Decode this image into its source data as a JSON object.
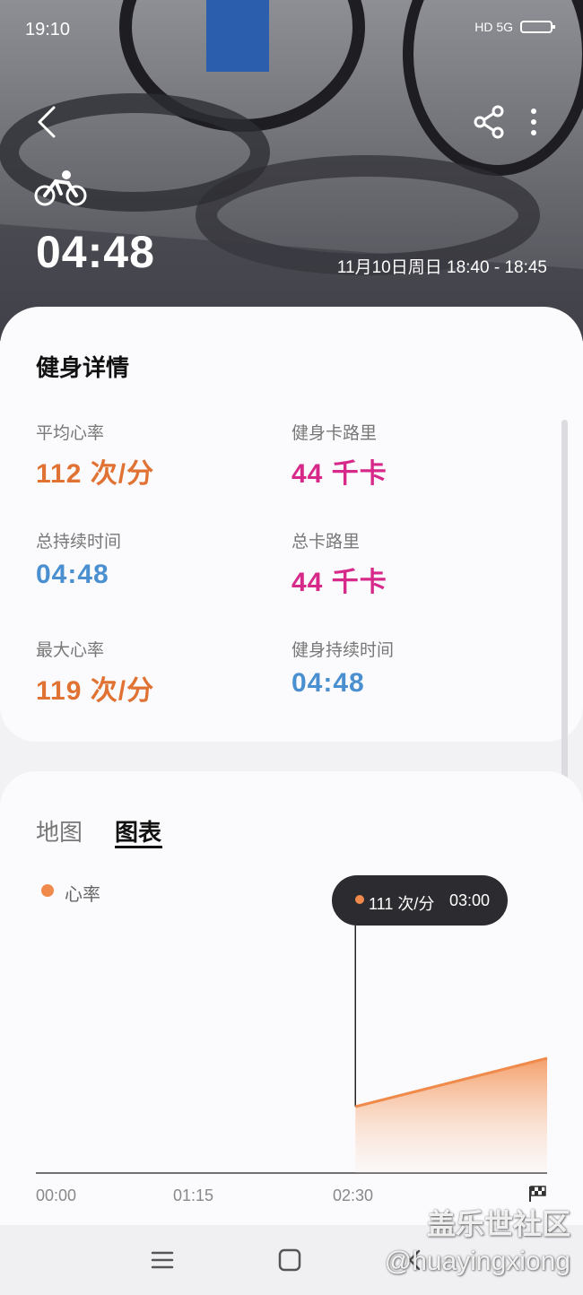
{
  "status_bar": {
    "time": "19:10",
    "indicators": "HD 5G"
  },
  "header": {
    "duration": "04:48",
    "date_range": "11月10日周日 18:40 - 18:45",
    "icons": [
      "back-icon",
      "share-icon",
      "more-icon",
      "cycling-icon"
    ]
  },
  "details": {
    "title": "健身详情",
    "stats": [
      {
        "label": "平均心率",
        "value": "112 次/分",
        "color": "#e07334"
      },
      {
        "label": "健身卡路里",
        "value": "44 千卡",
        "color": "#d7298a"
      },
      {
        "label": "总持续时间",
        "value": "04:48",
        "color": "#4a8fd0"
      },
      {
        "label": "总卡路里",
        "value": "44 千卡",
        "color": "#d7298a"
      },
      {
        "label": "最大心率",
        "value": "119 次/分",
        "color": "#e07334"
      },
      {
        "label": "健身持续时间",
        "value": "04:48",
        "color": "#4a8fd0"
      }
    ]
  },
  "chart_section": {
    "tabs": [
      {
        "label": "地图",
        "active": false
      },
      {
        "label": "图表",
        "active": true
      }
    ],
    "legend": "心率",
    "tooltip": {
      "value": "111 次/分",
      "time": "03:00"
    },
    "x_ticks": [
      "00:00",
      "01:15",
      "02:30"
    ]
  },
  "chart_data": {
    "type": "area",
    "series": [
      {
        "name": "心率",
        "points": [
          {
            "x": "03:00",
            "y": 111
          },
          {
            "x": "04:48",
            "y": 119
          }
        ]
      }
    ],
    "xlabel": "",
    "ylabel": "",
    "x_range": [
      "00:00",
      "04:48"
    ],
    "color": "#f08a4b"
  },
  "watermark": {
    "line1": "盖乐世社区",
    "line2": "@huayingxiong"
  }
}
